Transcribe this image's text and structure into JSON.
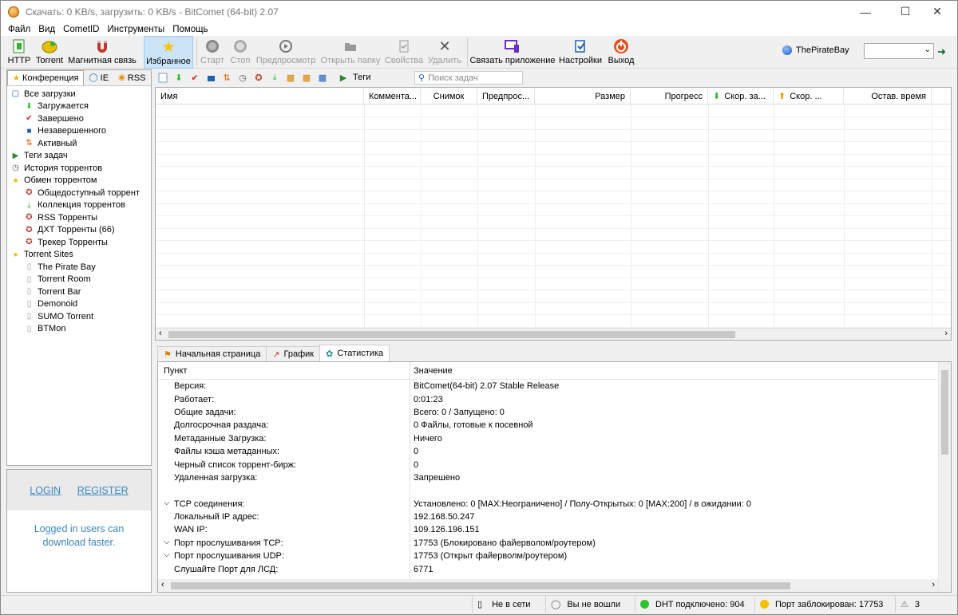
{
  "window": {
    "title": "Скачать: 0 KB/s, загрузить: 0 KB/s - BitComet (64-bit) 2.07"
  },
  "menu": [
    "Файл",
    "Вид",
    "CometID",
    "Инструменты",
    "Помощь"
  ],
  "toolbar": {
    "http": "HTTP",
    "torrent": "Torrent",
    "magnet": "Магнитная связь",
    "favorites": "Избранное",
    "start": "Старт",
    "stop": "Стоп",
    "preview": "Предпросмотр",
    "open_folder": "Открыть папку",
    "properties": "Свойства",
    "delete": "Удалить",
    "link_app": "Связать приложение",
    "settings": "Настройки",
    "exit": "Выход",
    "site": "ThePirateBay"
  },
  "left_tabs": [
    "Конференция",
    "IE",
    "RSS"
  ],
  "tree": [
    {
      "label": "Все загрузки",
      "level": 0,
      "icon": "downloads-icon"
    },
    {
      "label": "Загружается",
      "level": 1,
      "icon": "arrow-down-icon"
    },
    {
      "label": "Завершено",
      "level": 1,
      "icon": "check-icon"
    },
    {
      "label": "Незавершенного",
      "level": 1,
      "icon": "blue-square-icon"
    },
    {
      "label": "Активный",
      "level": 1,
      "icon": "up-down-icon"
    },
    {
      "label": "Теги задач",
      "level": 0,
      "icon": "tag-icon"
    },
    {
      "label": "История торрентов",
      "level": 0,
      "icon": "history-icon"
    },
    {
      "label": "Обмен торрентом",
      "level": 0,
      "icon": "folder-icon"
    },
    {
      "label": "Общедоступный торрент",
      "level": 1,
      "icon": "torrent-icon"
    },
    {
      "label": "Коллекция торрентов",
      "level": 1,
      "icon": "torrent-collection-icon"
    },
    {
      "label": "RSS Торренты",
      "level": 1,
      "icon": "torrent-icon"
    },
    {
      "label": "ДХТ Торренты (66)",
      "level": 1,
      "icon": "torrent-icon"
    },
    {
      "label": "Трекер Торренты",
      "level": 1,
      "icon": "torrent-icon"
    },
    {
      "label": "Torrent Sites",
      "level": 0,
      "icon": "folder-icon"
    },
    {
      "label": "The Pirate Bay",
      "level": 1,
      "icon": "page-icon"
    },
    {
      "label": "Torrent Room",
      "level": 1,
      "icon": "page-icon"
    },
    {
      "label": "Torrent Bar",
      "level": 1,
      "icon": "page-icon"
    },
    {
      "label": "Demonoid",
      "level": 1,
      "icon": "page-icon"
    },
    {
      "label": "SUMO Torrent",
      "level": 1,
      "icon": "page-icon"
    },
    {
      "label": "BTMon",
      "level": 1,
      "icon": "page-icon"
    }
  ],
  "promo": {
    "login": "LOGIN",
    "register": "REGISTER",
    "message": "Logged in users can download faster."
  },
  "tasks_toolbar": {
    "tags": "Теги",
    "search_placeholder": "Поиск задач"
  },
  "columns": [
    "Имя",
    "Коммента...",
    "Снимок",
    "Предпрос...",
    "Размер",
    "Прогресс",
    "Скор. за...",
    "Скор. ...",
    "Остав. время"
  ],
  "bottom_tabs": [
    "Начальная страница",
    "График",
    "Статистика"
  ],
  "stats": {
    "header_key": "Пункт",
    "header_value": "Значение",
    "rows": [
      {
        "k": "Версия:",
        "v": "BitComet(64-bit) 2.07 Stable Release",
        "caret": ""
      },
      {
        "k": "Работает:",
        "v": "0:01:23",
        "caret": ""
      },
      {
        "k": "Общие задачи:",
        "v": "Всего: 0 / Запущено: 0",
        "caret": ""
      },
      {
        "k": "Долгосрочная раздача:",
        "v": "0 Файлы, готовые к посевной",
        "caret": ""
      },
      {
        "k": "Метаданные Загрузка:",
        "v": "Ничего",
        "caret": ""
      },
      {
        "k": "Файлы кэша метаданных:",
        "v": "0",
        "caret": ""
      },
      {
        "k": "Черный список торрент-бирж:",
        "v": "0",
        "caret": ""
      },
      {
        "k": "Удаленная загрузка:",
        "v": "Запрешено",
        "caret": ""
      },
      {
        "k": "",
        "v": "",
        "caret": ""
      },
      {
        "k": "TCP соединения:",
        "v": "Установлено: 0 [MAX:Неограничено] / Полу-Открытых: 0 [MAX:200] / в ожидании: 0",
        "caret": "⌵"
      },
      {
        "k": "Локальный IP адрес:",
        "v": "192.168.50.247",
        "caret": ""
      },
      {
        "k": "WAN IP:",
        "v": "109.126.196.151",
        "caret": ""
      },
      {
        "k": "Порт прослушивания TCP:",
        "v": "17753 (Блокировано файерволом/роутером)",
        "caret": "⌵"
      },
      {
        "k": "Порт прослушивания UDP:",
        "v": "17753 (Открыт файерволм/роутером)",
        "caret": "⌵"
      },
      {
        "k": "Слушайте Порт для ЛСД:",
        "v": "6771",
        "caret": ""
      }
    ]
  },
  "status": {
    "offline": "Не в сети",
    "not_logged": "Вы не вошли",
    "dht": "DHT подключено: 904",
    "port": "Порт заблокирован: 17753",
    "count": "3",
    "dht_color": "#2ec22e",
    "port_color": "#f2c200"
  }
}
